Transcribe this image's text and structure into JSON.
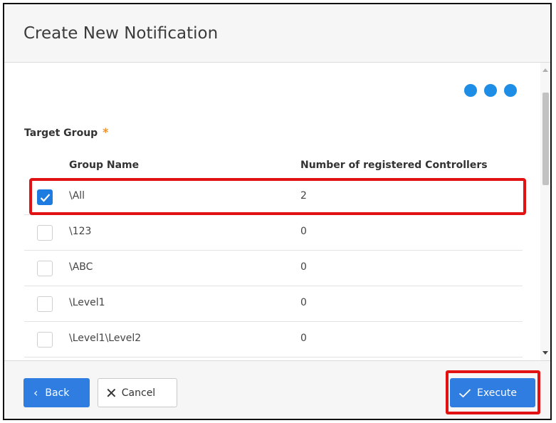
{
  "dialog": {
    "title": "Create New Notification"
  },
  "steps": {
    "count": 3,
    "color": "#1e8de6"
  },
  "form": {
    "target_group_label": "Target Group",
    "required_marker": "*"
  },
  "table": {
    "columns": [
      "Group Name",
      "Number of registered Controllers"
    ],
    "rows": [
      {
        "name": "\\All",
        "count": "2",
        "checked": true
      },
      {
        "name": "\\123",
        "count": "0",
        "checked": false
      },
      {
        "name": "\\ABC",
        "count": "0",
        "checked": false
      },
      {
        "name": "\\Level1",
        "count": "0",
        "checked": false
      },
      {
        "name": "\\Level1\\Level2",
        "count": "0",
        "checked": false
      }
    ]
  },
  "footer": {
    "back_label": "Back",
    "cancel_label": "Cancel",
    "execute_label": "Execute"
  },
  "colors": {
    "primary": "#2f7de1",
    "highlight": "#e31212",
    "required": "#f0932b"
  }
}
